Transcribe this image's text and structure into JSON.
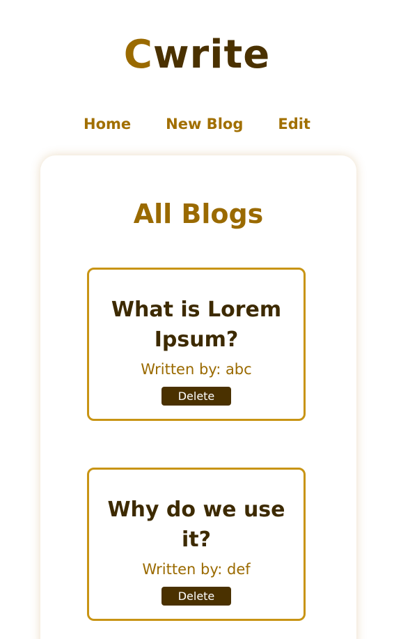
{
  "brand": {
    "first_letter": "C",
    "rest": "write",
    "colors": {
      "first_letter": "#9a6a00",
      "rest": "#4a3100"
    }
  },
  "nav": {
    "items": [
      {
        "label": "Home"
      },
      {
        "label": "New Blog"
      },
      {
        "label": "Edit"
      }
    ]
  },
  "main": {
    "title": "All Blogs",
    "blogs": [
      {
        "title": "What is Lorem Ipsum?",
        "author": "Written by: abc",
        "delete_label": "Delete"
      },
      {
        "title": "Why do we use it?",
        "author": "Written by: def",
        "delete_label": "Delete"
      }
    ]
  },
  "colors": {
    "accent": "#9a6a00",
    "dark": "#4a3100",
    "card_border": "#c89414"
  }
}
